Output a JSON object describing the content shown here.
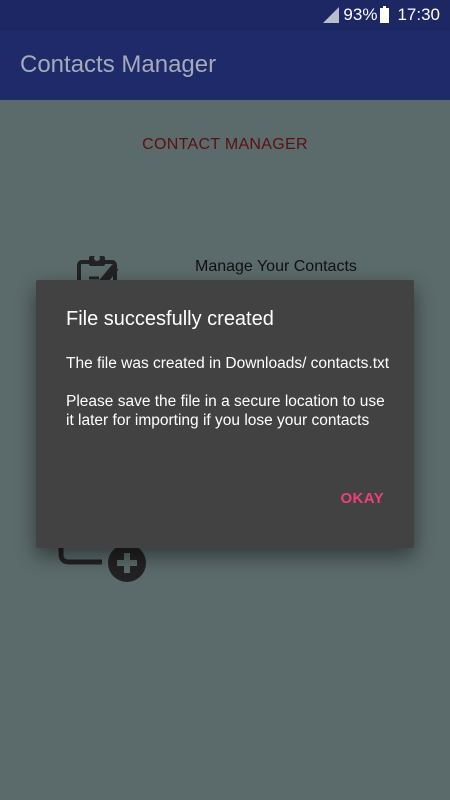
{
  "status_bar": {
    "battery": "93%",
    "time": "17:30"
  },
  "app_bar": {
    "title": "Contacts Manager"
  },
  "main": {
    "section_title": "CONTACT MANAGER",
    "manage_label": "Manage Your Contacts"
  },
  "dialog": {
    "title": "File succesfully created",
    "message_line1": "The file was created in Downloads/ contacts.txt",
    "message_line2": "Please save the file in a secure location to use it later for importing if you lose your contacts",
    "ok_button": "OKAY"
  },
  "colors": {
    "status_bar": "#1c2763",
    "app_bar": "#1e2a6a",
    "dimmed_background": "#5b6a6a",
    "dialog_background": "#424242",
    "accent": "#ef3f79",
    "section_title": "#5c1010"
  },
  "icons": [
    "signal-icon",
    "battery-icon",
    "clipboard-edit-icon",
    "add-contact-icon"
  ]
}
